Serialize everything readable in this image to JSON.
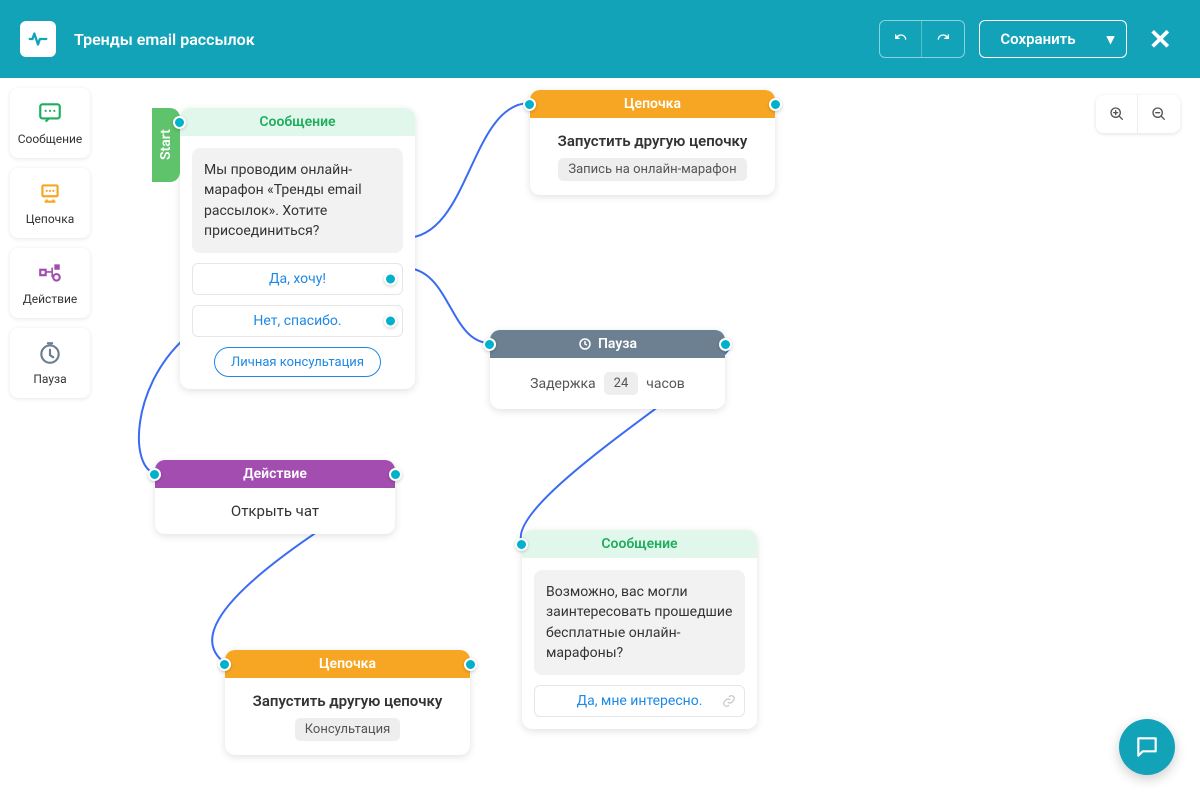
{
  "header": {
    "title": "Тренды email рассылок",
    "save": "Сохранить"
  },
  "sidebar": {
    "items": [
      {
        "label": "Сообщение"
      },
      {
        "label": "Цепочка"
      },
      {
        "label": "Действие"
      },
      {
        "label": "Пауза"
      }
    ]
  },
  "nodes": {
    "start_tag": "Start",
    "msg1": {
      "head": "Сообщение",
      "text": "Мы проводим онлайн-марафон «Тренды email рассылок». Хотите присоединиться?",
      "btn1": "Да, хочу!",
      "btn2": "Нет, спасибо.",
      "pill": "Личная консультация"
    },
    "chain1": {
      "head": "Цепочка",
      "title": "Запустить другую цепочку",
      "tag": "Запись на онлайн-марафон"
    },
    "pause": {
      "head": "Пауза",
      "prefix": "Задержка",
      "value": "24",
      "suffix": "часов"
    },
    "action": {
      "head": "Действие",
      "title": "Открыть чат"
    },
    "chain2": {
      "head": "Цепочка",
      "title": "Запустить другую цепочку",
      "tag": "Консультация"
    },
    "msg2": {
      "head": "Сообщение",
      "text": "Возможно, вас могли заинтересовать прошедшие бесплатные онлайн-марафоны?",
      "btn1": "Да, мне интересно."
    }
  }
}
